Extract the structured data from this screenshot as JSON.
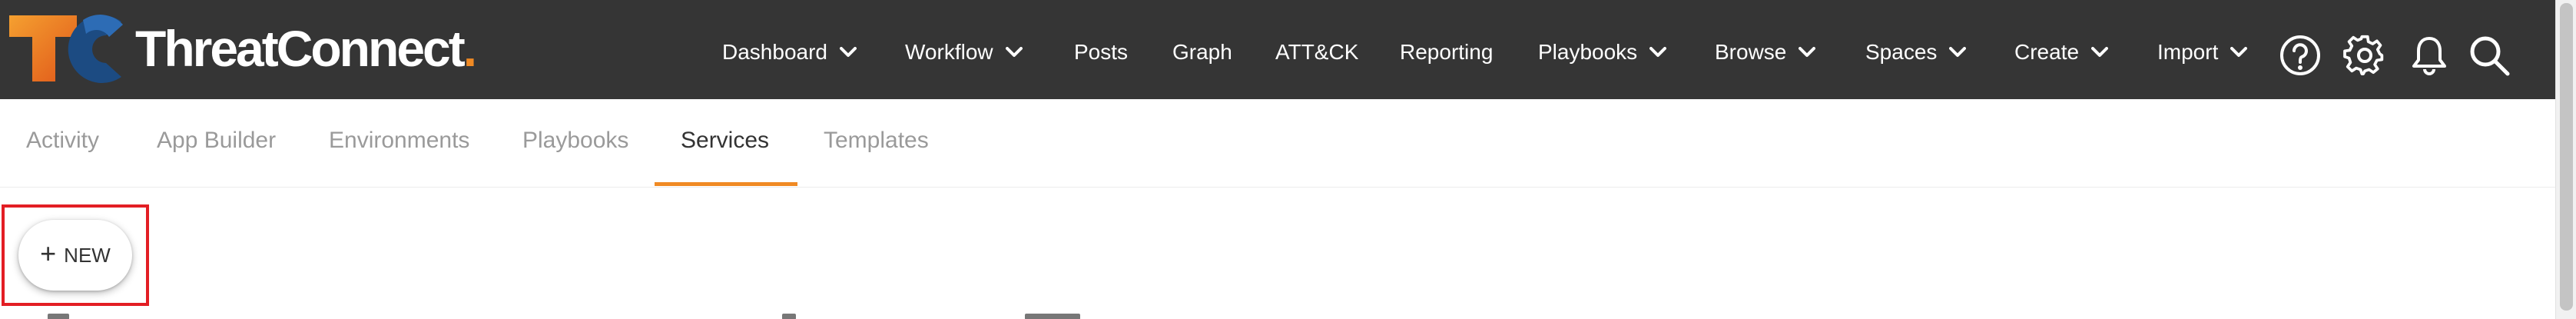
{
  "brand": {
    "name": "ThreatConnect",
    "accent_color": "#f08a24",
    "logo_blue": "#1c4b82"
  },
  "nav": {
    "items": [
      {
        "label": "Dashboard",
        "dropdown": true
      },
      {
        "label": "Workflow",
        "dropdown": true
      },
      {
        "label": "Posts",
        "dropdown": false
      },
      {
        "label": "Graph",
        "dropdown": false
      },
      {
        "label": "ATT&CK",
        "dropdown": false
      },
      {
        "label": "Reporting",
        "dropdown": false
      },
      {
        "label": "Playbooks",
        "dropdown": true
      },
      {
        "label": "Browse",
        "dropdown": true
      },
      {
        "label": "Spaces",
        "dropdown": true
      },
      {
        "label": "Create",
        "dropdown": true
      },
      {
        "label": "Import",
        "dropdown": true
      }
    ],
    "icons": [
      "help-icon",
      "gear-icon",
      "bell-icon",
      "search-icon"
    ]
  },
  "tabs": {
    "items": [
      "Activity",
      "App Builder",
      "Environments",
      "Playbooks",
      "Services",
      "Templates"
    ],
    "active": "Services"
  },
  "actions": {
    "new_label": "NEW",
    "new_icon": "plus-icon"
  },
  "colors": {
    "topbar": "#353535",
    "highlight": "#e31e24",
    "tab_inactive": "#9a9a9a",
    "tab_active": "#333333"
  }
}
